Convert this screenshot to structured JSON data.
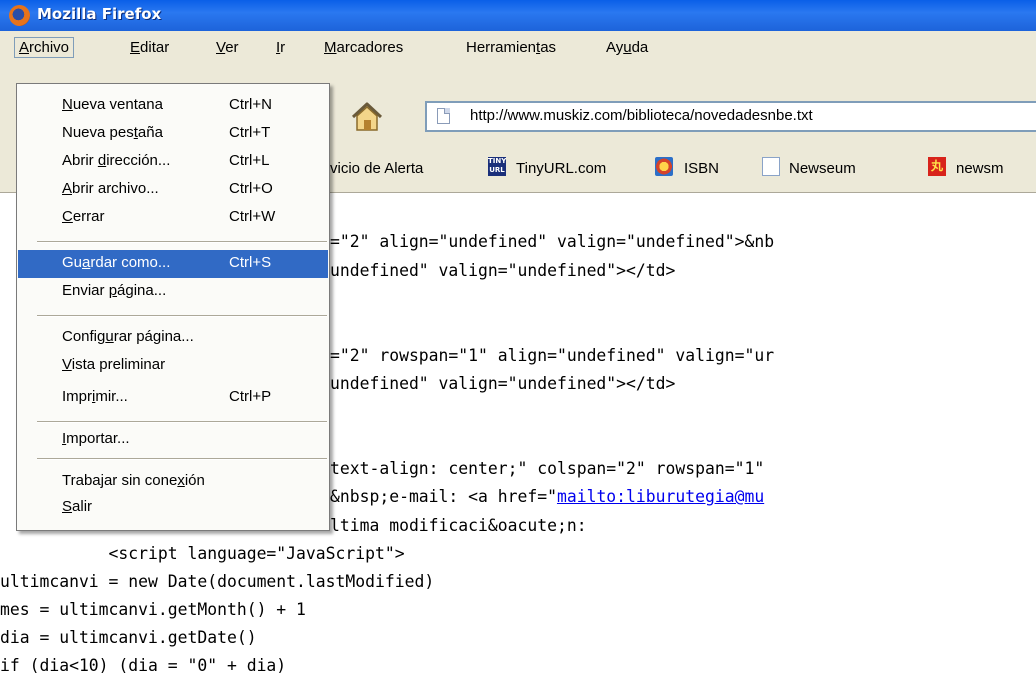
{
  "window": {
    "title": "Mozilla Firefox"
  },
  "menubar": {
    "items": [
      {
        "pre": "",
        "u": "A",
        "post": "rchivo"
      },
      {
        "pre": "",
        "u": "E",
        "post": "ditar"
      },
      {
        "pre": "",
        "u": "V",
        "post": "er"
      },
      {
        "pre": "",
        "u": "I",
        "post": "r"
      },
      {
        "pre": "",
        "u": "M",
        "post": "arcadores"
      },
      {
        "pre": "Herramien",
        "u": "t",
        "post": "as"
      },
      {
        "pre": "Ay",
        "u": "u",
        "post": "da"
      }
    ]
  },
  "navbar": {
    "url": "http://www.muskiz.com/biblioteca/novedadesnbe.txt"
  },
  "bookmarks": [
    {
      "label": "vicio de Alerta",
      "icon": "none"
    },
    {
      "label": "TinyURL.com",
      "icon": "tinyurl-icon"
    },
    {
      "label": "ISBN",
      "icon": "isbn-icon"
    },
    {
      "label": "Newseum",
      "icon": "page-icon"
    },
    {
      "label": "newsm",
      "icon": "news-icon"
    }
  ],
  "file_menu": {
    "items": [
      {
        "pre": "",
        "u": "N",
        "post": "ueva ventana",
        "shortcut": "Ctrl+N"
      },
      {
        "pre": "Nueva pes",
        "u": "t",
        "post": "aña",
        "shortcut": "Ctrl+T"
      },
      {
        "pre": "Abrir ",
        "u": "d",
        "post": "irección...",
        "shortcut": "Ctrl+L"
      },
      {
        "pre": "",
        "u": "A",
        "post": "brir archivo...",
        "shortcut": "Ctrl+O"
      },
      {
        "pre": "",
        "u": "C",
        "post": "errar",
        "shortcut": "Ctrl+W"
      },
      {
        "pre": "Gu",
        "u": "a",
        "post": "rdar como...",
        "shortcut": "Ctrl+S",
        "selected": true
      },
      {
        "pre": "Enviar ",
        "u": "p",
        "post": "ágina...",
        "shortcut": ""
      },
      {
        "pre": "Config",
        "u": "u",
        "post": "rar página...",
        "shortcut": ""
      },
      {
        "pre": "",
        "u": "V",
        "post": "ista preliminar",
        "shortcut": ""
      },
      {
        "pre": "Impr",
        "u": "i",
        "post": "mir...",
        "shortcut": "Ctrl+P"
      },
      {
        "pre": "",
        "u": "I",
        "post": "mportar...",
        "shortcut": ""
      },
      {
        "pre": "Trabajar sin cone",
        "u": "x",
        "post": "ión",
        "shortcut": ""
      },
      {
        "pre": "",
        "u": "S",
        "post": "alir",
        "shortcut": ""
      }
    ]
  },
  "code": {
    "lines": [
      "=\"2\" align=\"undefined\" valign=\"undefined\">&nb",
      "undefined\" valign=\"undefined\"></td>",
      "=\"2\" rowspan=\"1\" align=\"undefined\" valign=\"ur",
      "undefined\" valign=\"undefined\"></td>",
      "text-align: center;\" colspan=\"2\" rowspan=\"1\"",
      "&nbsp;e-mail: <a href=\"",
      "mailto:liburutegia@mu",
      "ltima modificaci&oacute;n:",
      "           <script language=\"JavaScript\">",
      "ultimcanvi = new Date(document.lastModified)",
      "mes = ultimcanvi.getMonth() + 1",
      "dia = ultimcanvi.getDate()",
      "if (dia<10) (dia = \"0\" + dia)"
    ]
  }
}
